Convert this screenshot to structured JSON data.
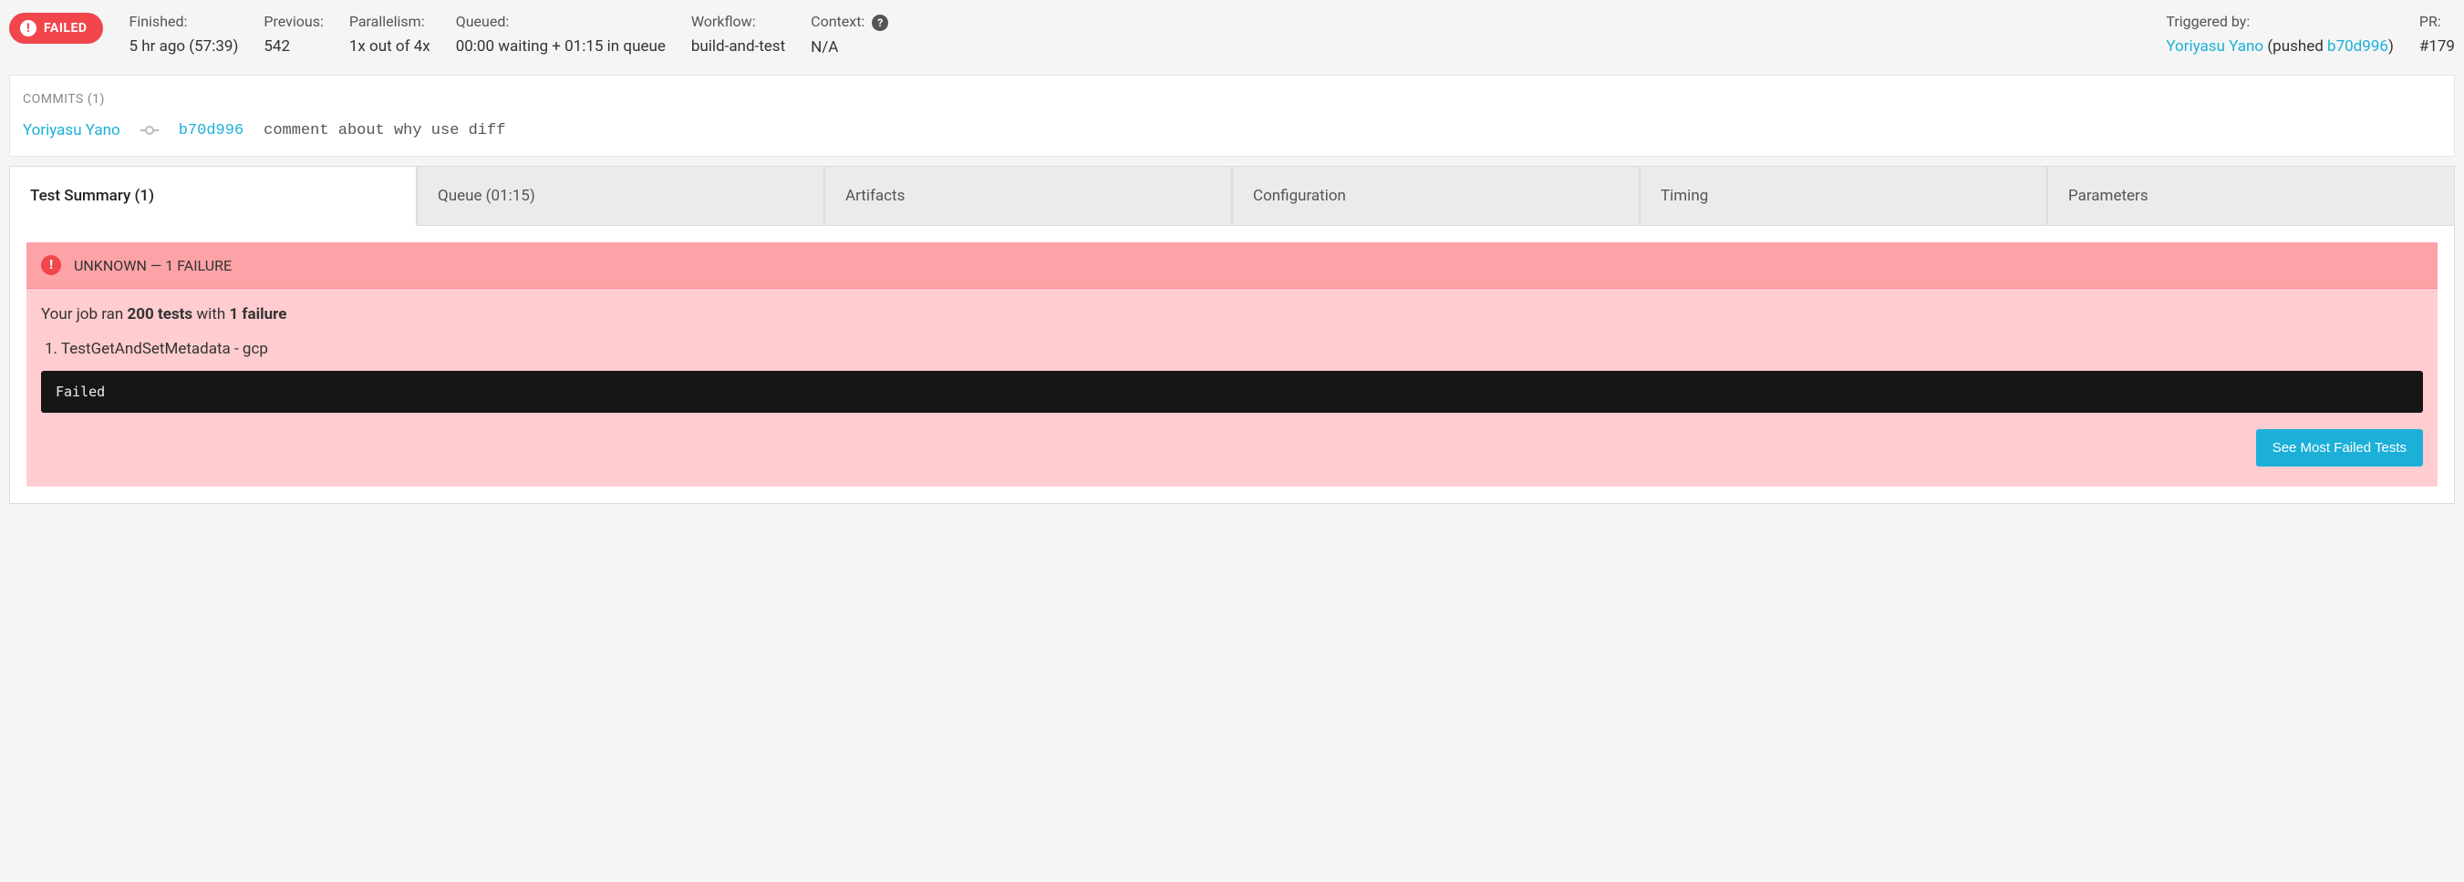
{
  "status": {
    "label": "FAILED"
  },
  "meta": {
    "finished": {
      "label": "Finished:",
      "value": "5 hr ago (57:39)"
    },
    "previous": {
      "label": "Previous:",
      "value": "542"
    },
    "parallelism": {
      "label": "Parallelism:",
      "value": "1x out of 4x"
    },
    "queued": {
      "label": "Queued:",
      "value": "00:00 waiting + 01:15 in queue"
    },
    "workflow": {
      "label": "Workflow:",
      "value": "build-and-test"
    },
    "context": {
      "label": "Context:",
      "value": "N/A"
    },
    "triggered": {
      "label": "Triggered by:",
      "author": "Yoriyasu Yano",
      "pushed_text": " (pushed ",
      "hash": "b70d996",
      "close": ")"
    },
    "pr": {
      "label": "PR:",
      "value": "#179"
    }
  },
  "commits": {
    "title": "COMMITS (1)",
    "row": {
      "author": "Yoriyasu Yano",
      "hash": "b70d996",
      "message": "comment about why use diff"
    }
  },
  "tabs": {
    "test_summary": "Test Summary (1)",
    "queue": "Queue (01:15)",
    "artifacts": "Artifacts",
    "configuration": "Configuration",
    "timing": "Timing",
    "parameters": "Parameters"
  },
  "alert": {
    "heading": "UNKNOWN — 1 FAILURE",
    "summary_prefix": "Your job ran ",
    "tests_count": "200 tests",
    "summary_mid": " with ",
    "failure_count": "1 failure",
    "item": "1. TestGetAndSetMetadata - gcp",
    "code": "Failed",
    "button": "See Most Failed Tests"
  }
}
